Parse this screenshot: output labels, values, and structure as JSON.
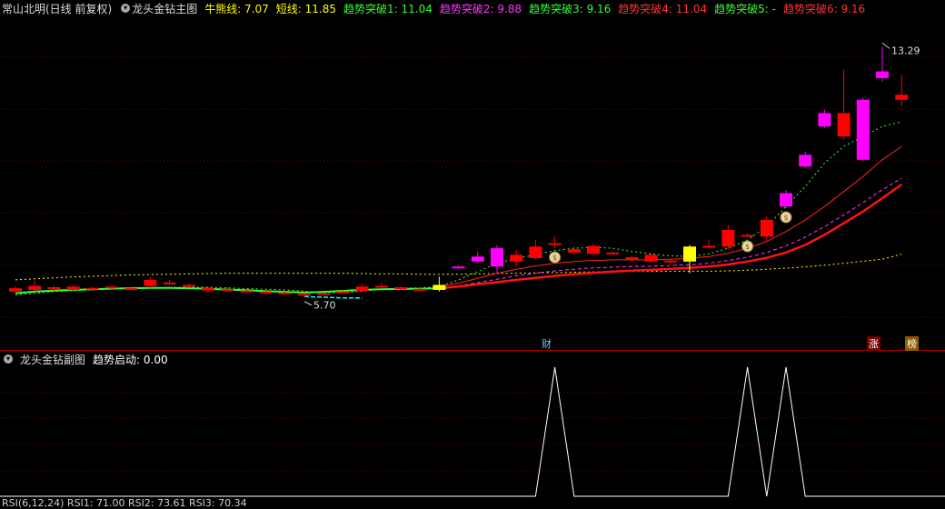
{
  "main_header": {
    "stock": "常山北明(日线 前复权)",
    "indicator": "龙头金钻主图",
    "lines": [
      {
        "label": "牛熊线: 7.07",
        "color": "#ffff00"
      },
      {
        "label": "短线: 11.85",
        "color": "#ffff00"
      },
      {
        "label": "趋势突破1: 11.04",
        "color": "#33ff33"
      },
      {
        "label": "趋势突破2: 9.88",
        "color": "#ff33ff"
      },
      {
        "label": "趋势突破3: 9.16",
        "color": "#33ff33"
      },
      {
        "label": "趋势突破4: 11.04",
        "color": "#ff3333"
      },
      {
        "label": "趋势突破5: -",
        "color": "#33ff33"
      },
      {
        "label": "趋势突破6: 9.16",
        "color": "#ff3333"
      }
    ]
  },
  "sub_header": {
    "indicator": "龙头金钻副图",
    "value": "趋势启动: 0.00"
  },
  "markers": {
    "cai": "财",
    "zhang": "涨",
    "bang": "榜"
  },
  "bottom_cut": {
    "text": "RSI(6,12,24)  RSI1: 71.00  RSI2: 73.61  RSI3: 70.34"
  },
  "colors": {
    "up": "#ff0000",
    "down_special": "#ff00ff",
    "highlight": "#ffff00",
    "grid": "#7a0000",
    "signal": "#ffffff"
  },
  "chart_data": [
    {
      "type": "candlestick",
      "title": "龙头金钻主图",
      "annotations": [
        {
          "text": "13.29",
          "role": "high"
        },
        {
          "text": "5.70",
          "role": "low"
        }
      ],
      "ylim": [
        4.2,
        14.2
      ],
      "candles": [
        {
          "o": 6.05,
          "c": 5.95,
          "h": 6.1,
          "l": 5.9,
          "color": "red"
        },
        {
          "o": 6.0,
          "c": 6.12,
          "h": 6.28,
          "l": 5.95,
          "color": "red"
        },
        {
          "o": 6.08,
          "c": 6.02,
          "h": 6.13,
          "l": 5.97,
          "color": "red"
        },
        {
          "o": 6.0,
          "c": 6.1,
          "h": 6.14,
          "l": 5.95,
          "color": "red"
        },
        {
          "o": 6.06,
          "c": 6.03,
          "h": 6.1,
          "l": 5.98,
          "color": "red"
        },
        {
          "o": 6.05,
          "c": 6.1,
          "h": 6.13,
          "l": 6.0,
          "color": "red"
        },
        {
          "o": 6.05,
          "c": 6.05,
          "h": 6.1,
          "l": 6.0,
          "color": "red"
        },
        {
          "o": 6.12,
          "c": 6.3,
          "h": 6.38,
          "l": 6.05,
          "color": "red"
        },
        {
          "o": 6.22,
          "c": 6.22,
          "h": 6.3,
          "l": 6.18,
          "color": "red"
        },
        {
          "o": 6.15,
          "c": 6.12,
          "h": 6.2,
          "l": 6.05,
          "color": "red"
        },
        {
          "o": 6.05,
          "c": 5.98,
          "h": 6.1,
          "l": 5.92,
          "color": "red"
        },
        {
          "o": 6.02,
          "c": 6.0,
          "h": 6.08,
          "l": 5.95,
          "color": "red"
        },
        {
          "o": 5.98,
          "c": 5.97,
          "h": 6.03,
          "l": 5.93,
          "color": "red"
        },
        {
          "o": 5.95,
          "c": 5.92,
          "h": 6.0,
          "l": 5.88,
          "color": "red"
        },
        {
          "o": 5.92,
          "c": 5.92,
          "h": 5.96,
          "l": 5.88,
          "color": "red"
        },
        {
          "o": 5.88,
          "c": 5.85,
          "h": 5.9,
          "l": 5.76,
          "color": "red"
        },
        {
          "o": 5.9,
          "c": 5.9,
          "h": 5.92,
          "l": 5.85,
          "color": "red"
        },
        {
          "o": 5.95,
          "c": 5.95,
          "h": 5.98,
          "l": 5.9,
          "color": "red"
        },
        {
          "o": 5.97,
          "c": 6.1,
          "h": 6.18,
          "l": 5.94,
          "color": "red"
        },
        {
          "o": 6.12,
          "c": 6.12,
          "h": 6.22,
          "l": 6.05,
          "color": "red"
        },
        {
          "o": 6.08,
          "c": 6.05,
          "h": 6.12,
          "l": 6.0,
          "color": "red"
        },
        {
          "o": 6.03,
          "c": 6.03,
          "h": 6.08,
          "l": 5.98,
          "color": "red"
        },
        {
          "o": 6.0,
          "c": 6.15,
          "h": 6.4,
          "l": 5.95,
          "color": "yellow"
        },
        {
          "o": 6.7,
          "c": 6.7,
          "h": 6.72,
          "l": 6.68,
          "color": "magenta"
        },
        {
          "o": 6.85,
          "c": 7.0,
          "h": 7.15,
          "l": 6.8,
          "color": "magenta"
        },
        {
          "o": 7.25,
          "c": 6.7,
          "h": 7.35,
          "l": 6.5,
          "color": "magenta"
        },
        {
          "o": 6.85,
          "c": 7.05,
          "h": 7.2,
          "l": 6.72,
          "color": "red"
        },
        {
          "o": 6.95,
          "c": 7.3,
          "h": 7.5,
          "l": 6.9,
          "color": "red"
        },
        {
          "o": 7.4,
          "c": 7.4,
          "h": 7.6,
          "l": 7.25,
          "color": "red"
        },
        {
          "o": 7.12,
          "c": 7.22,
          "h": 7.3,
          "l": 7.05,
          "color": "red"
        },
        {
          "o": 7.08,
          "c": 7.32,
          "h": 7.38,
          "l": 7.0,
          "color": "red"
        },
        {
          "o": 7.12,
          "c": 7.12,
          "h": 7.16,
          "l": 7.08,
          "color": "red"
        },
        {
          "o": 6.9,
          "c": 6.98,
          "h": 7.02,
          "l": 6.85,
          "color": "red"
        },
        {
          "o": 6.85,
          "c": 7.05,
          "h": 7.1,
          "l": 6.8,
          "color": "red"
        },
        {
          "o": 6.88,
          "c": 6.88,
          "h": 6.95,
          "l": 6.8,
          "color": "red"
        },
        {
          "o": 6.85,
          "c": 7.3,
          "h": 7.35,
          "l": 6.5,
          "color": "yellow"
        },
        {
          "o": 7.32,
          "c": 7.32,
          "h": 7.5,
          "l": 7.25,
          "color": "red"
        },
        {
          "o": 7.3,
          "c": 7.8,
          "h": 7.95,
          "l": 7.2,
          "color": "red"
        },
        {
          "o": 7.65,
          "c": 7.65,
          "h": 7.7,
          "l": 7.58,
          "color": "red"
        },
        {
          "o": 7.6,
          "c": 8.1,
          "h": 8.2,
          "l": 7.45,
          "color": "red"
        },
        {
          "o": 8.5,
          "c": 8.9,
          "h": 9.0,
          "l": 8.45,
          "color": "magenta"
        },
        {
          "o": 9.7,
          "c": 10.05,
          "h": 10.15,
          "l": 9.65,
          "color": "magenta"
        },
        {
          "o": 10.9,
          "c": 11.3,
          "h": 11.4,
          "l": 10.85,
          "color": "magenta"
        },
        {
          "o": 10.6,
          "c": 11.3,
          "h": 12.6,
          "l": 10.5,
          "color": "red"
        },
        {
          "o": 11.7,
          "c": 9.9,
          "h": 11.75,
          "l": 9.85,
          "color": "magenta"
        },
        {
          "o": 12.35,
          "c": 12.55,
          "h": 13.29,
          "l": 12.25,
          "color": "magenta"
        },
        {
          "o": 11.85,
          "c": 11.7,
          "h": 12.45,
          "l": 11.5,
          "color": "red"
        }
      ],
      "lines": {
        "bull_bear": [
          6.3,
          6.33,
          6.36,
          6.39,
          6.41,
          6.43,
          6.45,
          6.46,
          6.47,
          6.48,
          6.49,
          6.5,
          6.5,
          6.5,
          6.5,
          6.5,
          6.5,
          6.5,
          6.49,
          6.48,
          6.48,
          6.47,
          6.47,
          6.47,
          6.48,
          6.49,
          6.5,
          6.51,
          6.52,
          6.53,
          6.54,
          6.55,
          6.56,
          6.56,
          6.56,
          6.56,
          6.56,
          6.57,
          6.59,
          6.62,
          6.65,
          6.69,
          6.74,
          6.8,
          6.86,
          6.92,
          7.07
        ],
        "dotted_green": [
          5.85,
          5.9,
          5.95,
          5.98,
          6.0,
          6.02,
          6.03,
          6.05,
          6.07,
          6.08,
          6.08,
          6.06,
          6.04,
          6.02,
          6.0,
          5.96,
          5.92,
          5.92,
          5.96,
          6.02,
          6.05,
          6.06,
          6.1,
          6.3,
          6.55,
          6.8,
          6.95,
          7.05,
          7.18,
          7.25,
          7.28,
          7.25,
          7.15,
          7.08,
          7.02,
          7.0,
          7.08,
          7.25,
          7.5,
          7.9,
          8.5,
          9.1,
          9.8,
          10.3,
          10.6,
          10.9,
          11.04
        ],
        "thin_red": [
          null,
          null,
          null,
          null,
          null,
          null,
          null,
          null,
          null,
          null,
          null,
          null,
          null,
          null,
          null,
          null,
          null,
          null,
          null,
          null,
          null,
          null,
          6.1,
          6.2,
          6.35,
          6.5,
          6.62,
          6.72,
          6.8,
          6.85,
          6.88,
          6.9,
          6.9,
          6.9,
          6.92,
          6.95,
          7.0,
          7.1,
          7.25,
          7.45,
          7.75,
          8.1,
          8.5,
          8.95,
          9.4,
          9.9,
          10.3
        ],
        "magenta_dash": [
          null,
          null,
          null,
          null,
          null,
          null,
          null,
          null,
          null,
          null,
          null,
          null,
          null,
          null,
          null,
          null,
          null,
          null,
          null,
          null,
          null,
          null,
          6.05,
          6.12,
          6.22,
          6.32,
          6.42,
          6.5,
          6.57,
          6.62,
          6.66,
          6.68,
          6.7,
          6.71,
          6.73,
          6.75,
          6.8,
          6.88,
          6.98,
          7.12,
          7.32,
          7.58,
          7.9,
          8.25,
          8.62,
          9.0,
          9.35
        ],
        "thick_red": [
          null,
          null,
          null,
          null,
          null,
          null,
          null,
          null,
          null,
          null,
          null,
          null,
          null,
          null,
          null,
          null,
          null,
          null,
          null,
          null,
          null,
          null,
          6.05,
          6.1,
          6.17,
          6.23,
          6.3,
          6.36,
          6.42,
          6.47,
          6.51,
          6.55,
          6.58,
          6.6,
          6.63,
          6.66,
          6.7,
          6.76,
          6.85,
          6.96,
          7.12,
          7.35,
          7.65,
          8.0,
          8.35,
          8.75,
          9.16
        ],
        "green_solid": [
          5.9,
          5.95,
          5.98,
          6.0,
          6.02,
          6.04,
          6.05,
          6.06,
          6.06,
          6.05,
          6.03,
          6.01,
          5.99,
          5.96,
          5.94,
          5.92,
          5.94,
          5.97,
          6.0,
          6.02,
          6.03,
          6.03,
          6.05
        ],
        "cyan_segment": [
          5.8,
          5.78,
          5.76,
          5.76
        ]
      },
      "money_bags": [
        28,
        38,
        40
      ]
    },
    {
      "type": "line",
      "title": "龙头金钻副图",
      "series_name": "趋势启动",
      "ylim": [
        0,
        1
      ],
      "signal_days": [
        28,
        38,
        40
      ]
    }
  ]
}
